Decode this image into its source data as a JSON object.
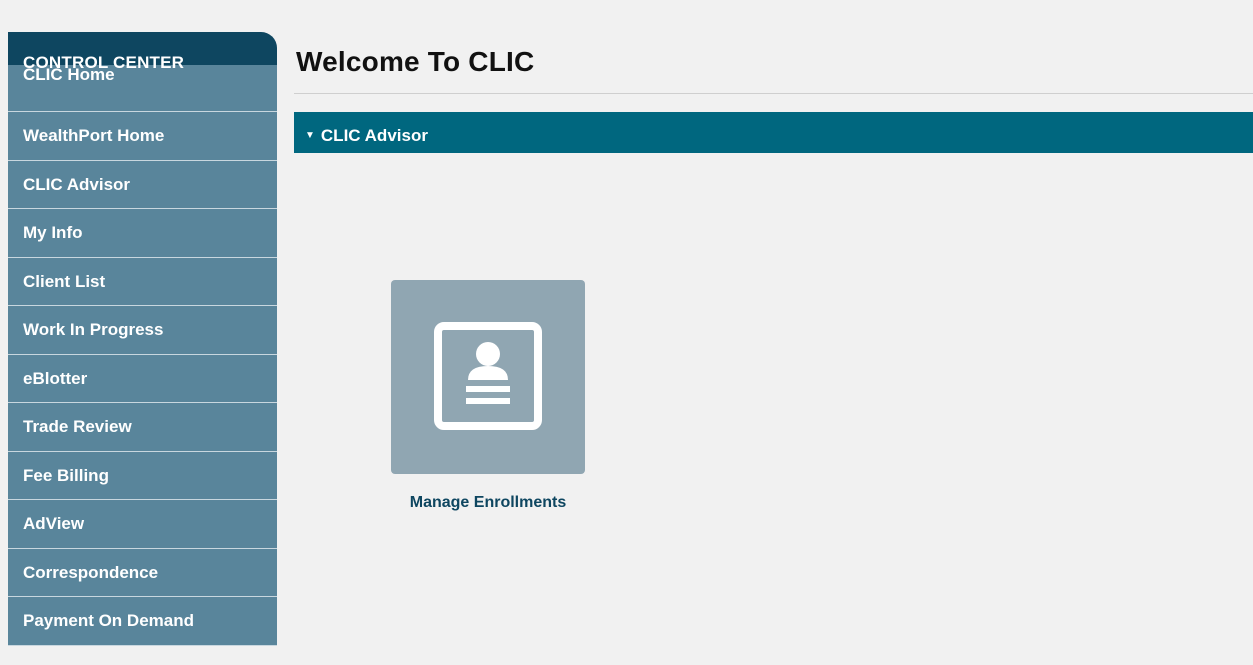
{
  "sidebar": {
    "header": "CONTROL CENTER",
    "items": [
      {
        "label": "CLIC Home"
      },
      {
        "label": "WealthPort Home"
      },
      {
        "label": "CLIC Advisor"
      },
      {
        "label": "My Info"
      },
      {
        "label": "Client List"
      },
      {
        "label": "Work In Progress"
      },
      {
        "label": "eBlotter"
      },
      {
        "label": "Trade Review"
      },
      {
        "label": "Fee Billing"
      },
      {
        "label": "AdView"
      },
      {
        "label": "Correspondence"
      },
      {
        "label": "Payment On Demand"
      }
    ]
  },
  "main": {
    "title": "Welcome To CLIC",
    "section": {
      "label": "CLIC Advisor",
      "expanded": true
    },
    "tiles": [
      {
        "label": "Manage Enrollments",
        "icon": "enrollment-card-icon"
      }
    ]
  },
  "colors": {
    "sidebar_header": "#0e4660",
    "sidebar_item": "#59859b",
    "section_bar": "#00677f",
    "tile": "#90a6b2",
    "tile_label": "#0e4660",
    "background": "#f1f1f1"
  }
}
